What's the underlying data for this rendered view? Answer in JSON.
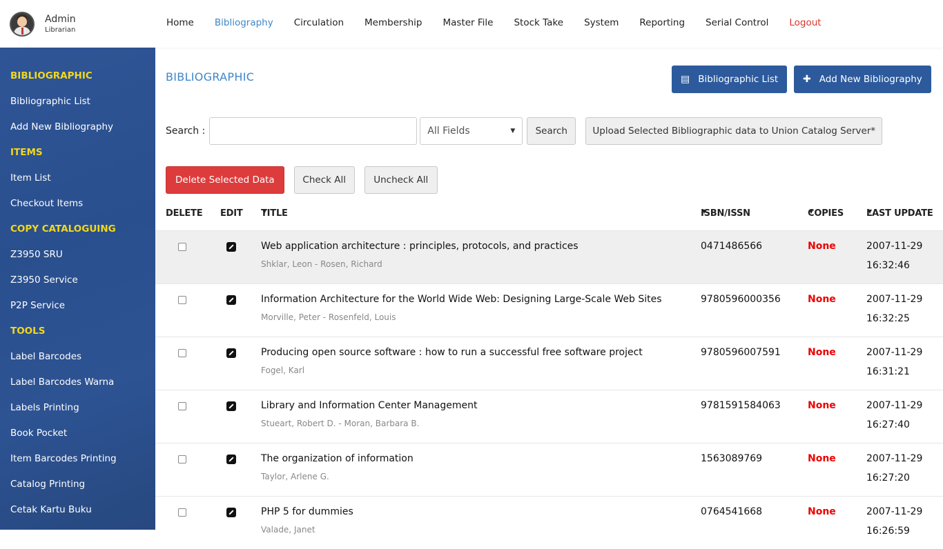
{
  "user": {
    "name": "Admin",
    "role": "Librarian"
  },
  "nav": [
    {
      "label": "Home"
    },
    {
      "label": "Bibliography",
      "active": true
    },
    {
      "label": "Circulation"
    },
    {
      "label": "Membership"
    },
    {
      "label": "Master File"
    },
    {
      "label": "Stock Take"
    },
    {
      "label": "System"
    },
    {
      "label": "Reporting"
    },
    {
      "label": "Serial Control"
    },
    {
      "label": "Logout"
    }
  ],
  "sidebar": {
    "sections": [
      {
        "title": "BIBLIOGRAPHIC",
        "items": [
          "Bibliographic List",
          "Add New Bibliography"
        ]
      },
      {
        "title": "ITEMS",
        "items": [
          "Item List",
          "Checkout Items"
        ]
      },
      {
        "title": "COPY CATALOGUING",
        "items": [
          "Z3950 SRU",
          "Z3950 Service",
          "P2P Service"
        ]
      },
      {
        "title": "TOOLS",
        "items": [
          "Label Barcodes",
          "Label Barcodes Warna",
          "Labels Printing",
          "Book Pocket",
          "Item Barcodes Printing",
          "Catalog Printing",
          "Cetak Kartu Buku"
        ]
      }
    ]
  },
  "main": {
    "title": "BIBLIOGRAPHIC",
    "list_button": "Bibliographic List",
    "add_button": "Add New Bibliography",
    "search_label": "Search :",
    "search_value": "",
    "field_select": "All Fields",
    "search_button": "Search",
    "upload_button": "Upload Selected Bibliographic data to Union Catalog Server*",
    "delete_button": "Delete Selected Data",
    "check_all": "Check All",
    "uncheck_all": "Uncheck All"
  },
  "table": {
    "headers": {
      "delete": "DELETE",
      "edit": "EDIT",
      "title": "TITLE",
      "isbn": "ISBN/ISSN",
      "copies": "COPIES",
      "last_update": "LAST UPDATE"
    },
    "rows": [
      {
        "title": "Web application architecture : principles, protocols, and practices",
        "author": "Shklar, Leon - Rosen, Richard",
        "isbn": "0471486566",
        "copies": "None",
        "date": "2007-11-29",
        "time": "16:32:46"
      },
      {
        "title": "Information Architecture for the World Wide Web: Designing Large-Scale Web Sites",
        "author": "Morville, Peter - Rosenfeld, Louis",
        "isbn": "9780596000356",
        "copies": "None",
        "date": "2007-11-29",
        "time": "16:32:25"
      },
      {
        "title": "Producing open source software : how to run a successful free software project",
        "author": "Fogel, Karl",
        "isbn": "9780596007591",
        "copies": "None",
        "date": "2007-11-29",
        "time": "16:31:21"
      },
      {
        "title": "Library and Information Center Management",
        "author": "Stueart, Robert D. - Moran, Barbara B.",
        "isbn": "9781591584063",
        "copies": "None",
        "date": "2007-11-29",
        "time": "16:27:40"
      },
      {
        "title": "The organization of information",
        "author": "Taylor, Arlene G.",
        "isbn": "1563089769",
        "copies": "None",
        "date": "2007-11-29",
        "time": "16:27:20"
      },
      {
        "title": "PHP 5 for dummies",
        "author": "Valade, Janet",
        "isbn": "0764541668",
        "copies": "None",
        "date": "2007-11-29",
        "time": "16:26:59"
      }
    ]
  },
  "colors": {
    "sidebar": "#2d5393",
    "accent": "#3d87c9",
    "section": "#f3d81a",
    "danger": "#dd3c3c",
    "primary": "#2c5a9c"
  }
}
